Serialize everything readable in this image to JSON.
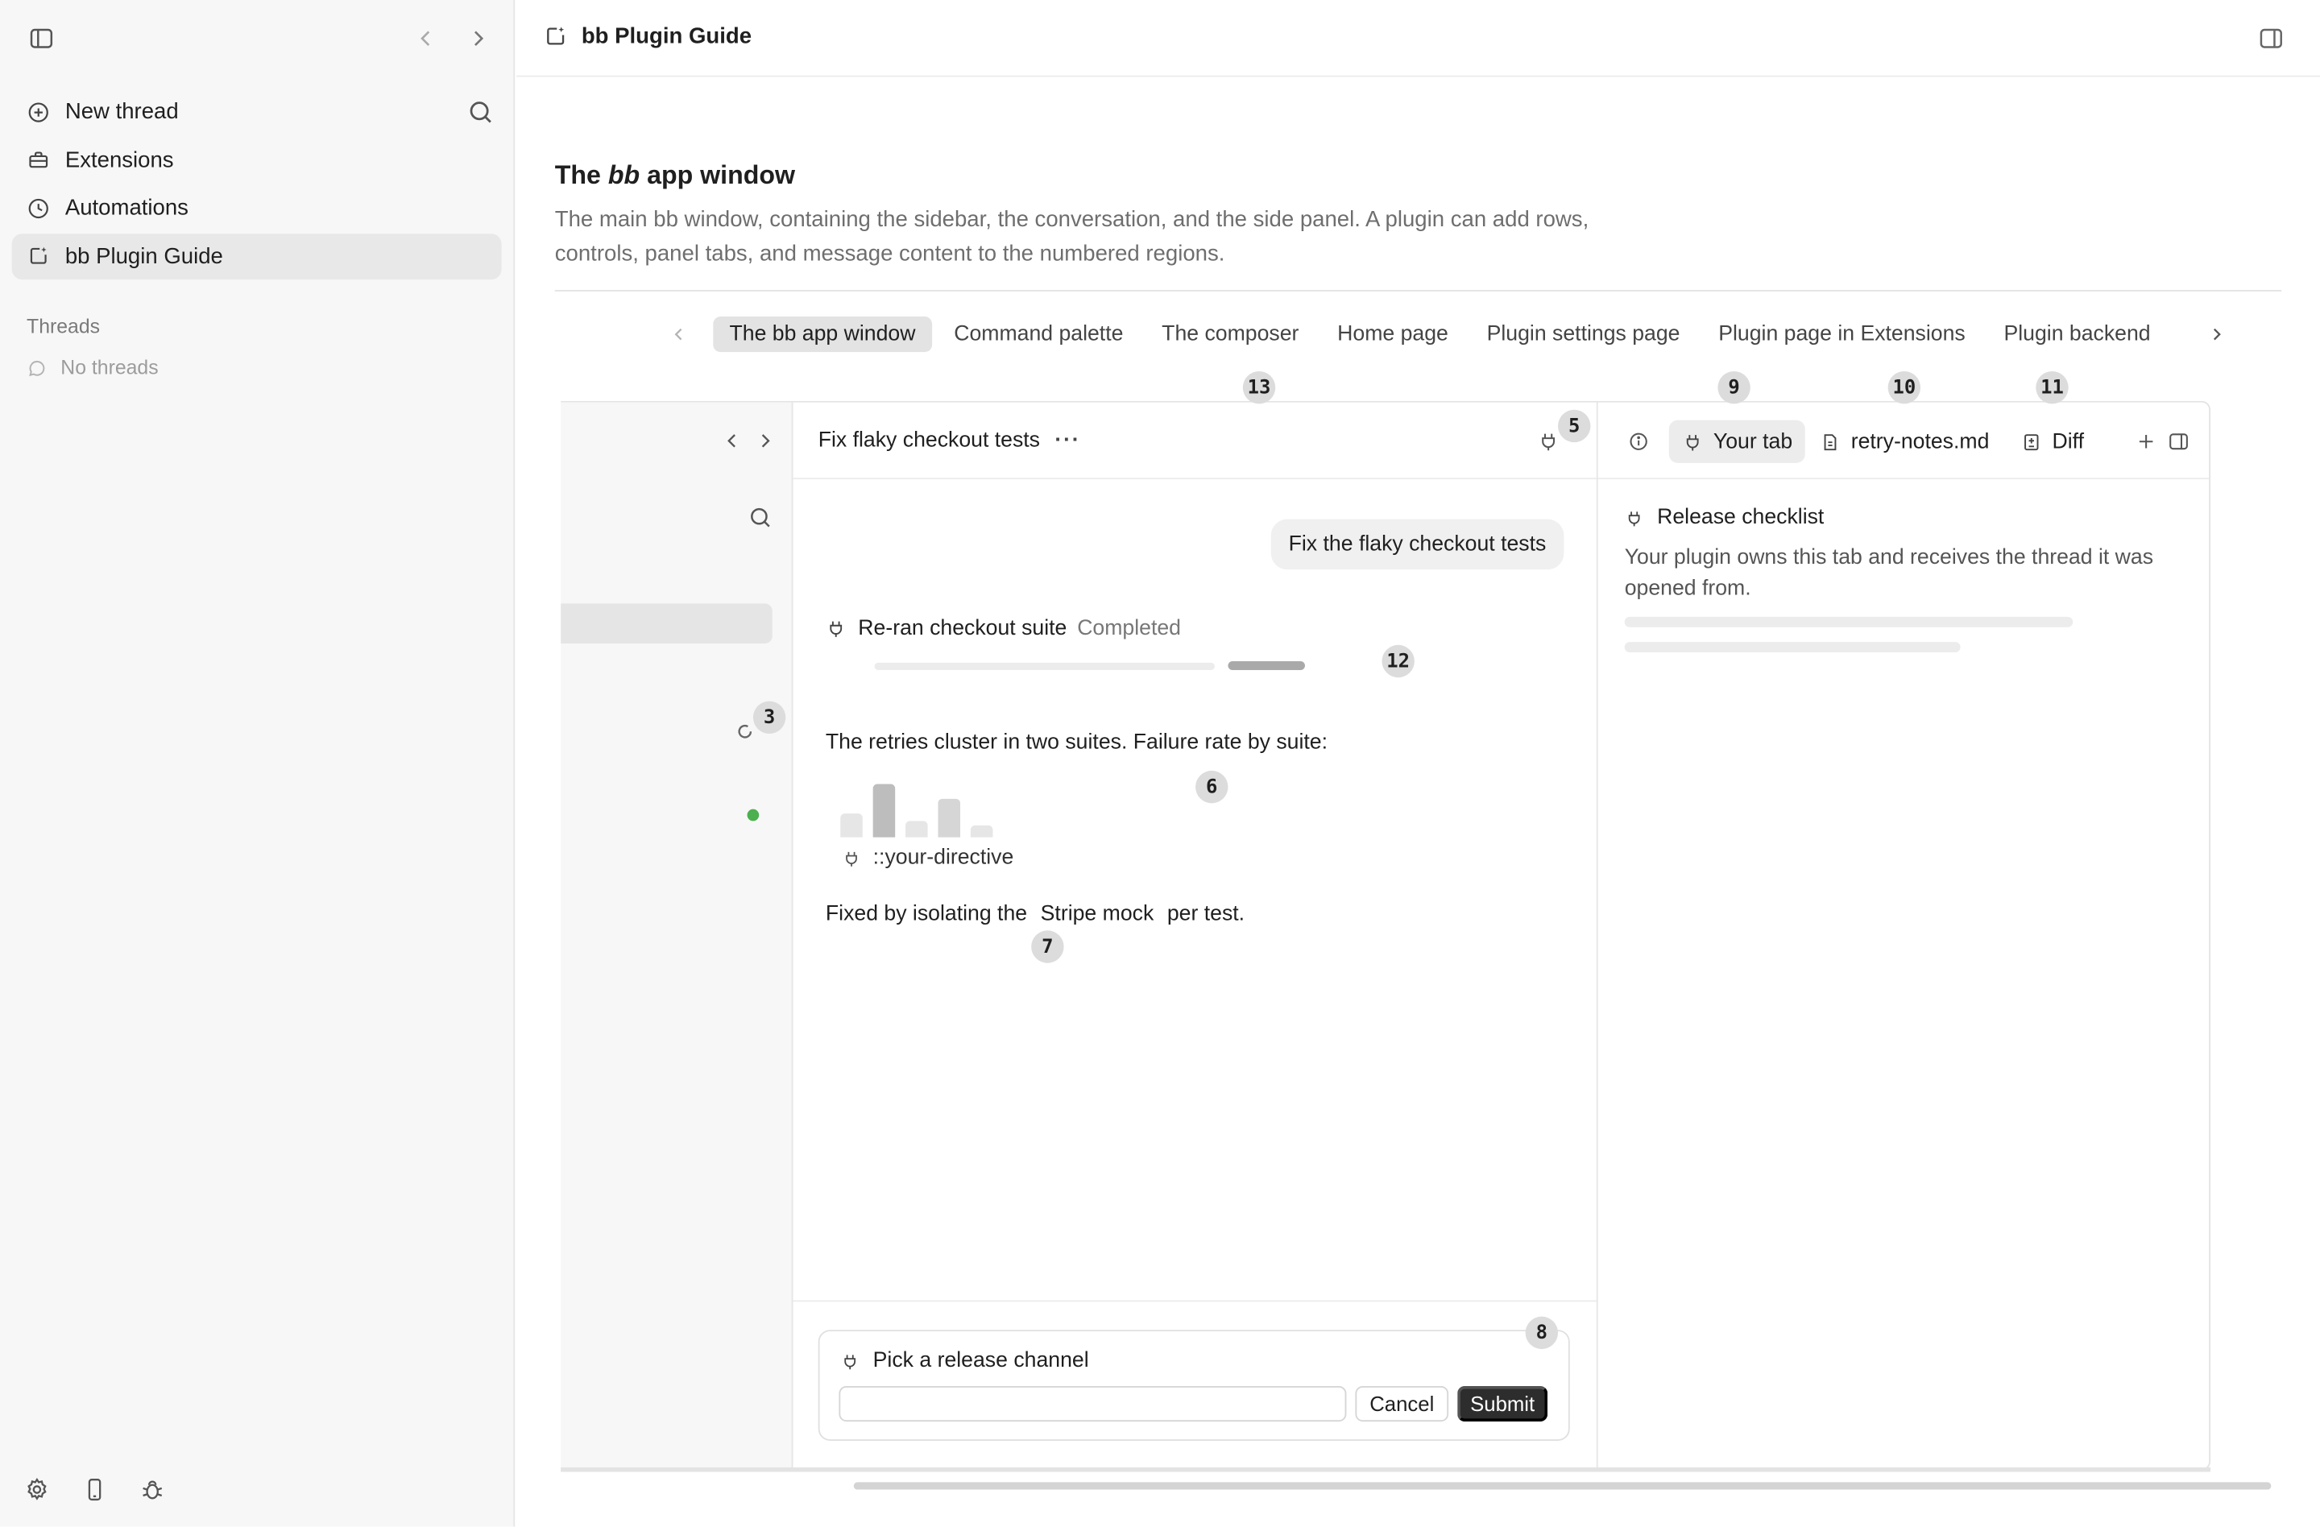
{
  "sidebar": {
    "nav": [
      {
        "label": "New thread",
        "icon": "plus-circle-icon"
      },
      {
        "label": "Extensions",
        "icon": "toolbox-icon"
      },
      {
        "label": "Automations",
        "icon": "clock-icon"
      },
      {
        "label": "bb Plugin Guide",
        "icon": "plugin-page-icon"
      }
    ],
    "threads_heading": "Threads",
    "threads_empty": "No threads"
  },
  "topbar": {
    "title": "bb Plugin Guide"
  },
  "doc": {
    "title_prefix": "The ",
    "title_em": "bb",
    "title_suffix": " app window",
    "description": "The main bb window, containing the sidebar, the conversation, and the side panel. A plugin can add rows, controls, panel tabs, and message content to the numbered regions."
  },
  "tabs": [
    {
      "label": "The bb app window",
      "active": true
    },
    {
      "label": "Command palette",
      "active": false
    },
    {
      "label": "The composer",
      "active": false
    },
    {
      "label": "Home page",
      "active": false
    },
    {
      "label": "Plugin settings page",
      "active": false
    },
    {
      "label": "Plugin page in Extensions",
      "active": false
    },
    {
      "label": "Plugin backend",
      "active": false
    }
  ],
  "mock": {
    "conversation": {
      "title": "Fix flaky checkout tests",
      "more": "···",
      "user_message": "Fix the flaky checkout tests",
      "task_title": "Re-ran checkout suite",
      "task_status": "Completed",
      "summary": "The retries cluster in two suites. Failure rate by suite:",
      "directive": "::your-directive",
      "fix_prefix": "Fixed by isolating the",
      "fix_code": "Stripe mock",
      "fix_suffix": "per test."
    },
    "failure_rate_bars": [
      0.45,
      1.0,
      0.3,
      0.72,
      0.22
    ],
    "composer": {
      "label": "Pick a release channel",
      "input_value": "",
      "cancel": "Cancel",
      "submit": "Submit"
    },
    "panel": {
      "tabs": [
        {
          "label": "Your tab",
          "icon": "plugin-icon",
          "active": true
        },
        {
          "label": "retry-notes.md",
          "icon": "file-icon",
          "active": false
        },
        {
          "label": "Diff",
          "icon": "diff-icon",
          "active": false
        }
      ],
      "title": "Release checklist",
      "description": "Your plugin owns this tab and receives the thread it was opened from."
    },
    "badges": {
      "b3": "3",
      "b5": "5",
      "b6": "6",
      "b7": "7",
      "b8": "8",
      "b9": "9",
      "b10": "10",
      "b11": "11",
      "b12": "12",
      "b13": "13"
    }
  },
  "colors": {
    "accent_dark": "#2d2d2d",
    "status_green": "#4caf50",
    "sidebar_bg": "#f7f7f7"
  }
}
